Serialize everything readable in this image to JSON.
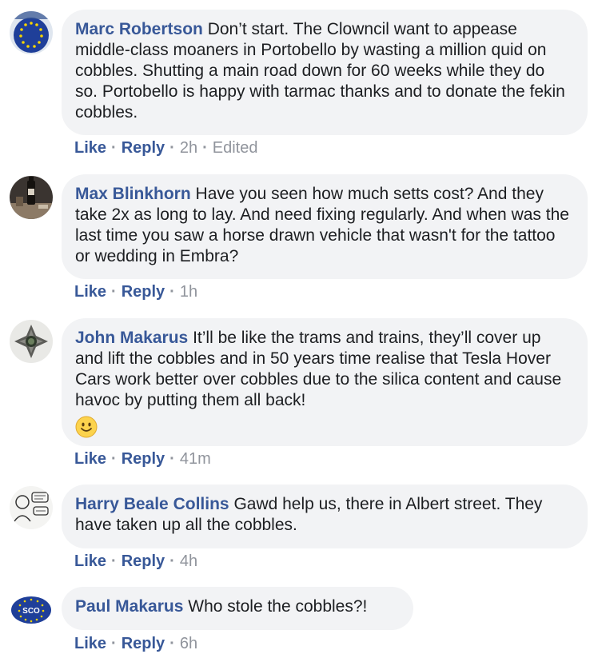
{
  "comments": [
    {
      "author": "Marc Robertson",
      "text": "Don’t start. The Clowncil want to appease middle-class moaners in Portobello by wasting a million quid on cobbles. Shutting a main road down for 60 weeks while they do so. Portobello is happy with tarmac thanks and to donate the fekin cobbles.",
      "like": "Like",
      "reply": "Reply",
      "time": "2h",
      "edited": "Edited",
      "avatar_icon": "eu-stars-avatar"
    },
    {
      "author": "Max Blinkhorn",
      "text": "Have you seen how much setts cost? And they take 2x as long to lay. And need fixing regularly. And when was the last time you saw a horse drawn vehicle that wasn't for the tattoo or wedding in Embra?",
      "like": "Like",
      "reply": "Reply",
      "time": "1h",
      "avatar_icon": "bottle-photo-avatar"
    },
    {
      "author": "John Makarus",
      "text": "It’ll be like the trams and trains, they’ll cover up and lift the cobbles and in 50 years time realise that Tesla Hover Cars work better over cobbles due to the silica content and cause havoc by putting them all back!",
      "emoji": "smile-emoji",
      "like": "Like",
      "reply": "Reply",
      "time": "41m",
      "avatar_icon": "cross-medal-avatar"
    },
    {
      "author": "Harry Beale Collins",
      "text": "Gawd help us, there in Albert street. They have taken up all the cobbles.",
      "like": "Like",
      "reply": "Reply",
      "time": "4h",
      "avatar_icon": "sketch-avatar"
    },
    {
      "author": "Paul Makarus",
      "text": "Who stole the cobbles?!",
      "like": "Like",
      "reply": "Reply",
      "time": "6h",
      "avatar_icon": "sco-eu-avatar",
      "avatar_text": "SCO"
    }
  ],
  "colors": {
    "author": "#385898",
    "bubble": "#f2f3f5",
    "meta": "#90949c"
  }
}
